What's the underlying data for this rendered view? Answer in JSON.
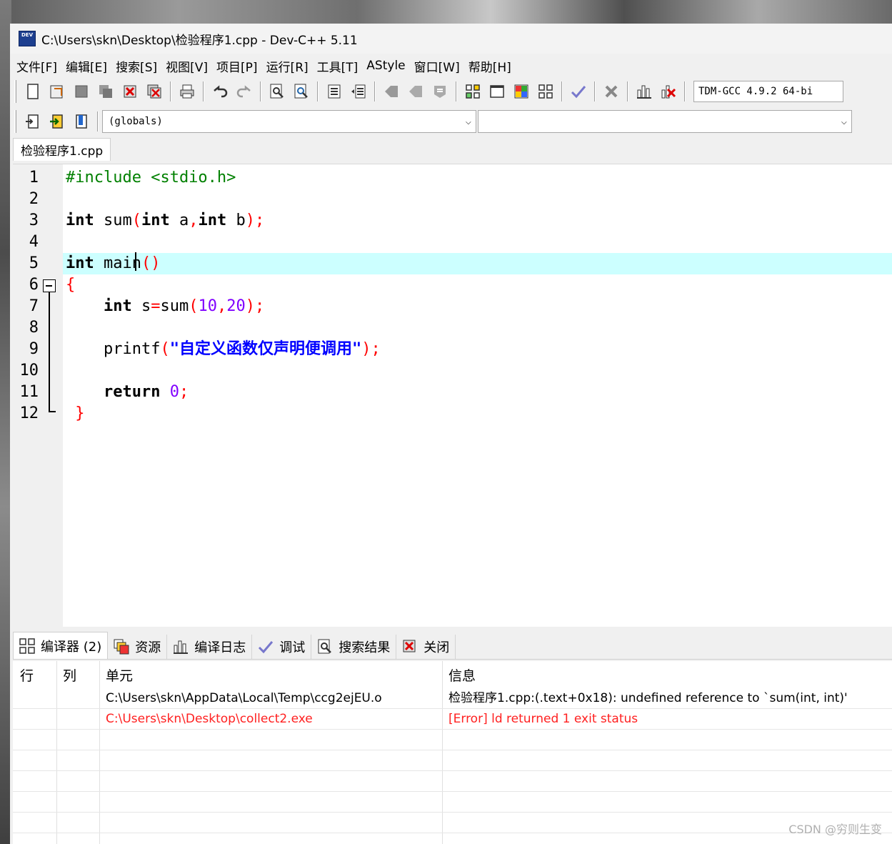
{
  "window": {
    "title": "C:\\Users\\skn\\Desktop\\检验程序1.cpp - Dev-C++ 5.11",
    "app_icon_text": "DEV"
  },
  "menu": [
    "文件[F]",
    "编辑[E]",
    "搜索[S]",
    "视图[V]",
    "项目[P]",
    "运行[R]",
    "工具[T]",
    "AStyle",
    "窗口[W]",
    "帮助[H]"
  ],
  "toolbar": {
    "compiler": "TDM-GCC 4.9.2 64-bi",
    "scope_combo": "(globals)",
    "member_combo": ""
  },
  "editor": {
    "file_tab": "检验程序1.cpp",
    "line_numbers": [
      "1",
      "2",
      "3",
      "4",
      "5",
      "6",
      "7",
      "8",
      "9",
      "10",
      "11",
      "12"
    ],
    "highlight_line": 5
  },
  "bottom_tabs": [
    "编译器 (2)",
    "资源",
    "编译日志",
    "调试",
    "搜索结果",
    "关闭"
  ],
  "messages": {
    "headers": {
      "line": "行",
      "col": "列",
      "unit": "单元",
      "info": "信息"
    },
    "rows": [
      {
        "line": "",
        "col": "",
        "unit": "C:\\Users\\skn\\AppData\\Local\\Temp\\ccg2ejEU.o",
        "info": "检验程序1.cpp:(.text+0x18): undefined reference to `sum(int, int)'",
        "error": false
      },
      {
        "line": "",
        "col": "",
        "unit": "C:\\Users\\skn\\Desktop\\collect2.exe",
        "info": "[Error] ld returned 1 exit status",
        "error": true
      }
    ]
  },
  "watermark": "CSDN @穷则生变",
  "colors": {
    "highlight_line": "#ccffff",
    "keyword": "#000000",
    "preprocessor": "#008000",
    "punctuation": "#ff0000",
    "number": "#8000ff",
    "string": "#0000ff",
    "error_text": "#ff2020"
  }
}
